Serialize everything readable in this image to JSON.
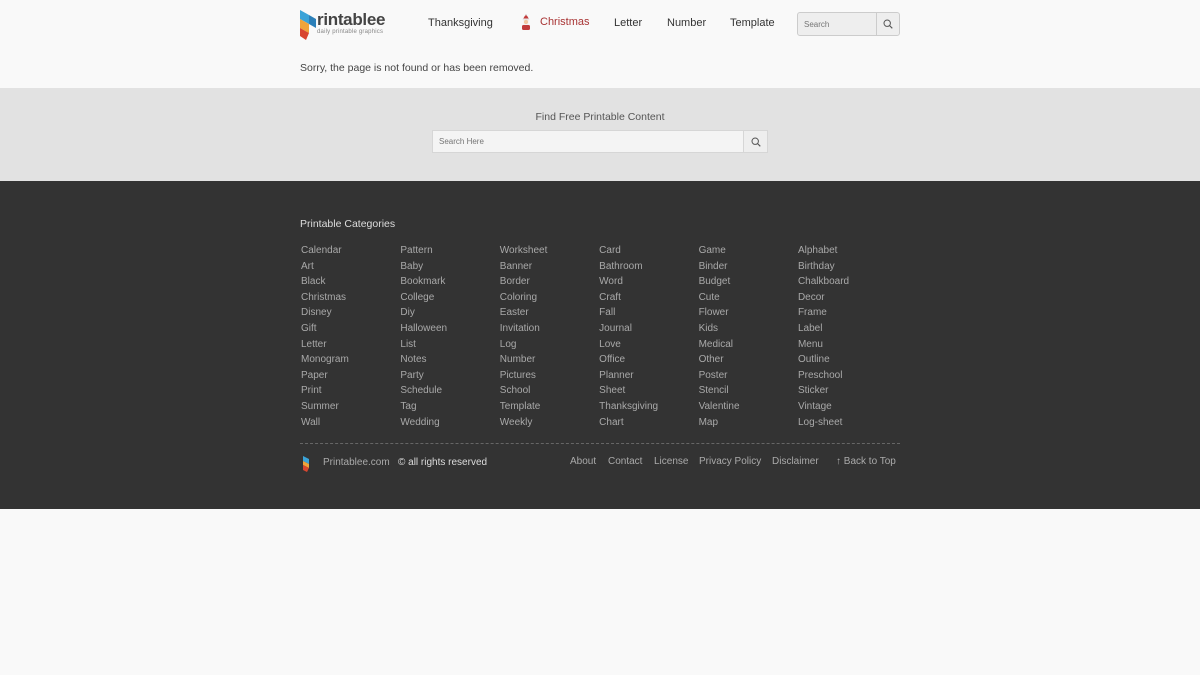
{
  "brand": {
    "name": "rintablee",
    "tagline": "daily printable graphics"
  },
  "nav": {
    "items": [
      "Thanksgiving",
      "Christmas",
      "Letter",
      "Number",
      "Template"
    ]
  },
  "header_search": {
    "placeholder": "Search"
  },
  "message": "Sorry, the page is not found or has been removed.",
  "find": {
    "title": "Find Free Printable Content",
    "placeholder": "Search Here"
  },
  "footer": {
    "categories_title": "Printable Categories",
    "columns": [
      [
        "Calendar",
        "Art",
        "Black",
        "Christmas",
        "Disney",
        "Gift",
        "Letter",
        "Monogram",
        "Paper",
        "Print",
        "Summer",
        "Wall"
      ],
      [
        "Pattern",
        "Baby",
        "Bookmark",
        "College",
        "Diy",
        "Halloween",
        "List",
        "Notes",
        "Party",
        "Schedule",
        "Tag",
        "Wedding"
      ],
      [
        "Worksheet",
        "Banner",
        "Border",
        "Coloring",
        "Easter",
        "Invitation",
        "Log",
        "Number",
        "Pictures",
        "School",
        "Template",
        "Weekly"
      ],
      [
        "Card",
        "Bathroom",
        "Word",
        "Craft",
        "Fall",
        "Journal",
        "Love",
        "Office",
        "Planner",
        "Sheet",
        "Thanksgiving",
        "Chart"
      ],
      [
        "Game",
        "Binder",
        "Budget",
        "Cute",
        "Flower",
        "Kids",
        "Medical",
        "Other",
        "Poster",
        "Stencil",
        "Valentine",
        "Map"
      ],
      [
        "Alphabet",
        "Birthday",
        "Chalkboard",
        "Decor",
        "Frame",
        "Label",
        "Menu",
        "Outline",
        "Preschool",
        "Sticker",
        "Vintage",
        "Log-sheet"
      ]
    ],
    "site": "Printablee.com",
    "copyright": "© all rights reserved",
    "links": [
      "About",
      "Contact",
      "License",
      "Privacy Policy",
      "Disclaimer",
      "↑ Back to Top"
    ]
  },
  "colors": {
    "accent_christmas": "#a83333",
    "footer_bg": "#333333",
    "find_band_bg": "#e2e2e2"
  }
}
